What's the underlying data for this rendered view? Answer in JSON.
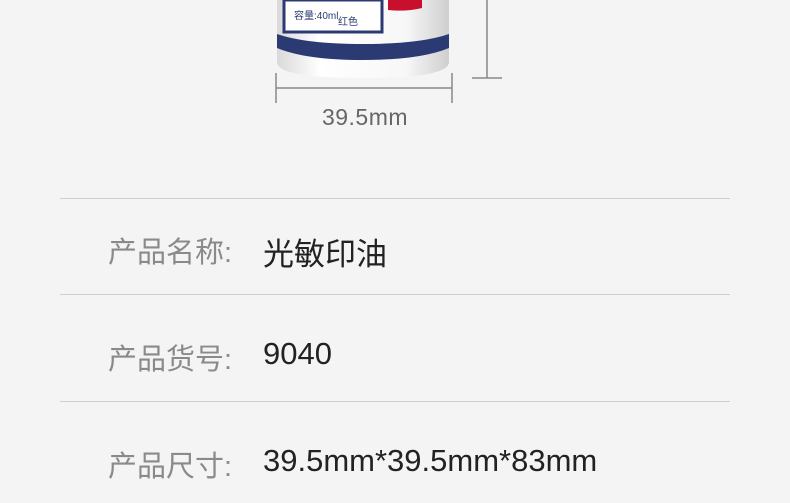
{
  "product_image": {
    "bottle_label_text": "容量:40ml",
    "bottle_color_text": "红色",
    "width_dimension": "39.5mm"
  },
  "specs": [
    {
      "label": "产品名称:",
      "value": "光敏印油"
    },
    {
      "label": "产品货号:",
      "value": "9040"
    },
    {
      "label": "产品尺寸:",
      "value": "39.5mm*39.5mm*83mm"
    }
  ],
  "colors": {
    "background": "#f4f4f4",
    "divider": "#cfcfcf",
    "label_text": "#8a8a8a",
    "value_text": "#222222",
    "bottle_stripe": "#2b3a73",
    "bottle_red": "#c8102e"
  }
}
